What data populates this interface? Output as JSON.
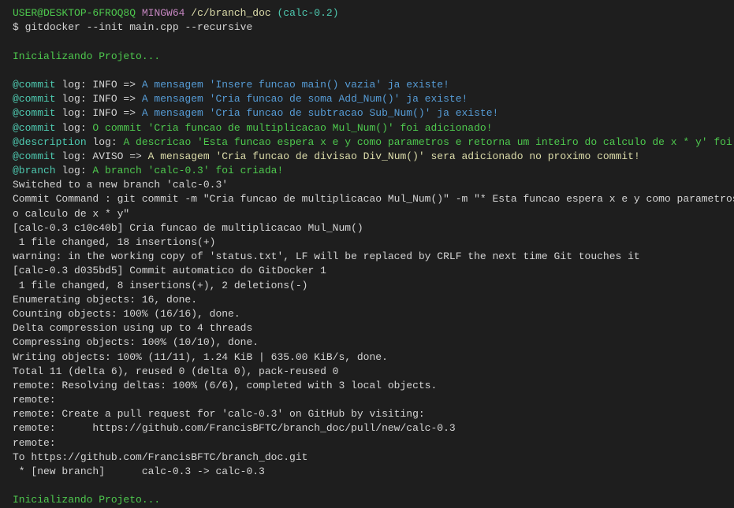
{
  "p": {
    "user": "USER@DESKTOP-6FROQ8Q",
    "sys": "MINGW64",
    "path": "/c/branch_doc",
    "branch": "(calc-0.2)",
    "sym": "$",
    "cmd": "gitdocker --init main.cpp --recursive"
  },
  "init": "Inicializando Projeto...",
  "l1": {
    "a": "@commit",
    "b": " log: INFO => ",
    "c": "A mensagem 'Insere funcao main() vazia' ja existe!"
  },
  "l2": {
    "a": "@commit",
    "b": " log: INFO => ",
    "c": "A mensagem 'Cria funcao de soma Add_Num()' ja existe!"
  },
  "l3": {
    "a": "@commit",
    "b": " log: INFO => ",
    "c": "A mensagem 'Cria funcao de subtracao Sub_Num()' ja existe!"
  },
  "l4": {
    "a": "@commit",
    "b": " log: ",
    "c": "O commit 'Cria funcao de multiplicacao Mul_Num()' foi adicionado!"
  },
  "l5": {
    "a": "@description",
    "b": " log: ",
    "c": "A descricao 'Esta funcao espera x e y como parametros e retorna um inteiro do calculo de x * y' foi adicionado!"
  },
  "l6": {
    "a": "@commit",
    "b": " log: AVISO => ",
    "c": "A mensagem 'Cria funcao de divisao Div_Num()' sera adicionado no proximo commit!"
  },
  "l7": {
    "a": "@branch",
    "b": " log: ",
    "c": "A branch 'calc-0.3' foi criada!"
  },
  "o": [
    "Switched to a new branch 'calc-0.3'",
    "Commit Command : git commit -m \"Cria funcao de multiplicacao Mul_Num()\" -m \"* Esta funcao espera x e y como parametros e retorna u",
    "o calculo de x * y\"",
    "[calc-0.3 c10c40b] Cria funcao de multiplicacao Mul_Num()",
    " 1 file changed, 18 insertions(+)",
    "warning: in the working copy of 'status.txt', LF will be replaced by CRLF the next time Git touches it",
    "[calc-0.3 d035bd5] Commit automatico do GitDocker 1",
    " 1 file changed, 8 insertions(+), 2 deletions(-)",
    "Enumerating objects: 16, done.",
    "Counting objects: 100% (16/16), done.",
    "Delta compression using up to 4 threads",
    "Compressing objects: 100% (10/10), done.",
    "Writing objects: 100% (11/11), 1.24 KiB | 635.00 KiB/s, done.",
    "Total 11 (delta 6), reused 0 (delta 0), pack-reused 0",
    "remote: Resolving deltas: 100% (6/6), completed with 3 local objects.",
    "remote:",
    "remote: Create a pull request for 'calc-0.3' on GitHub by visiting:",
    "remote:      https://github.com/FrancisBFTC/branch_doc/pull/new/calc-0.3",
    "remote:",
    "To https://github.com/FrancisBFTC/branch_doc.git",
    " * [new branch]      calc-0.3 -> calc-0.3"
  ],
  "init2": "Inicializando Projeto..."
}
